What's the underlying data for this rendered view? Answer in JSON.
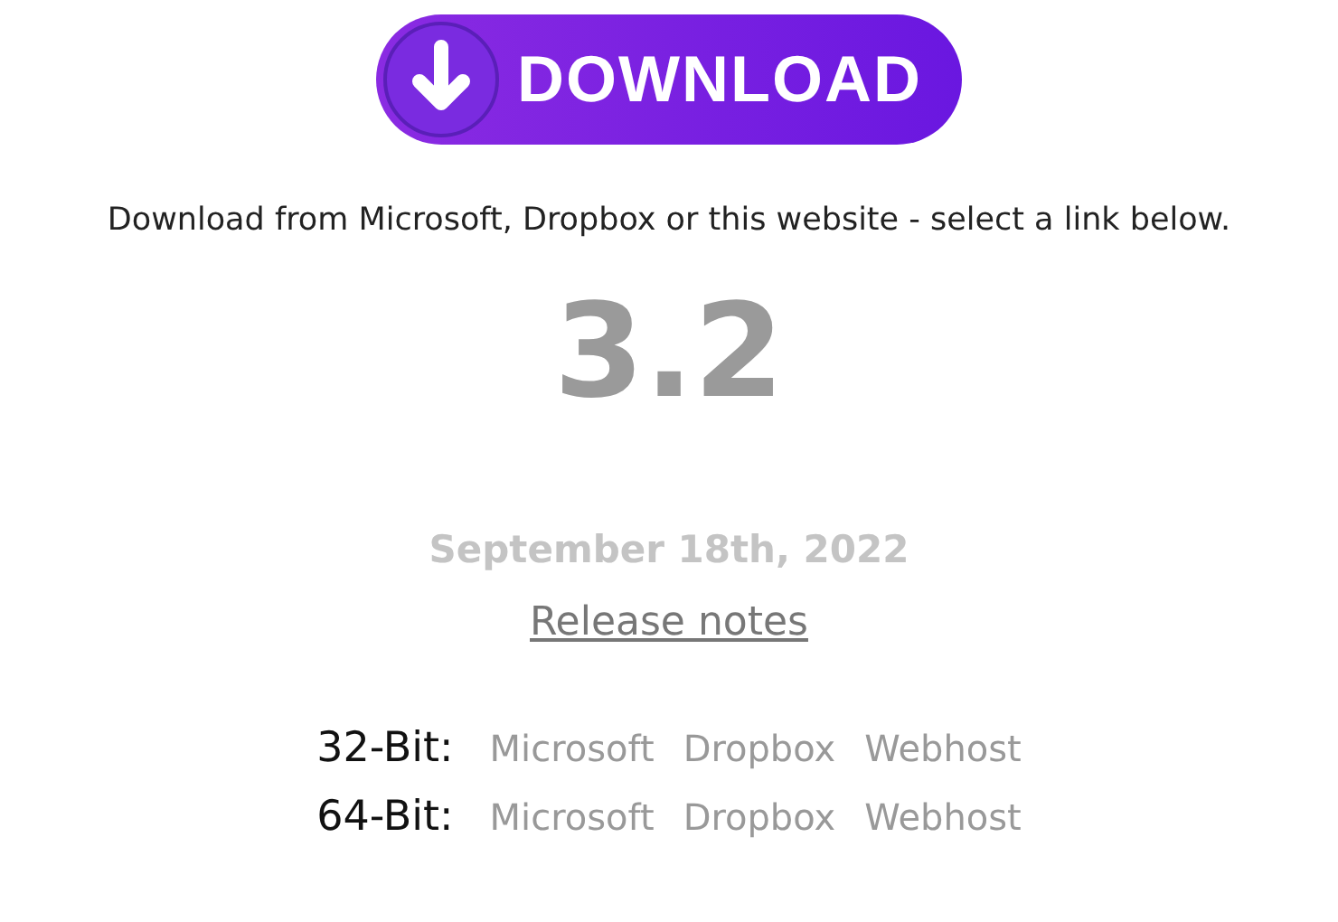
{
  "download_button": {
    "label": "DOWNLOAD"
  },
  "intro": "Download from Microsoft, Dropbox or this website - select a link below.",
  "version": "3.2",
  "date": "September 18th, 2022",
  "release_notes_link": "Release notes",
  "downloads": [
    {
      "label": "32-Bit:",
      "links": [
        "Microsoft",
        "Dropbox",
        "Webhost"
      ]
    },
    {
      "label": "64-Bit:",
      "links": [
        "Microsoft",
        "Dropbox",
        "Webhost"
      ]
    }
  ]
}
